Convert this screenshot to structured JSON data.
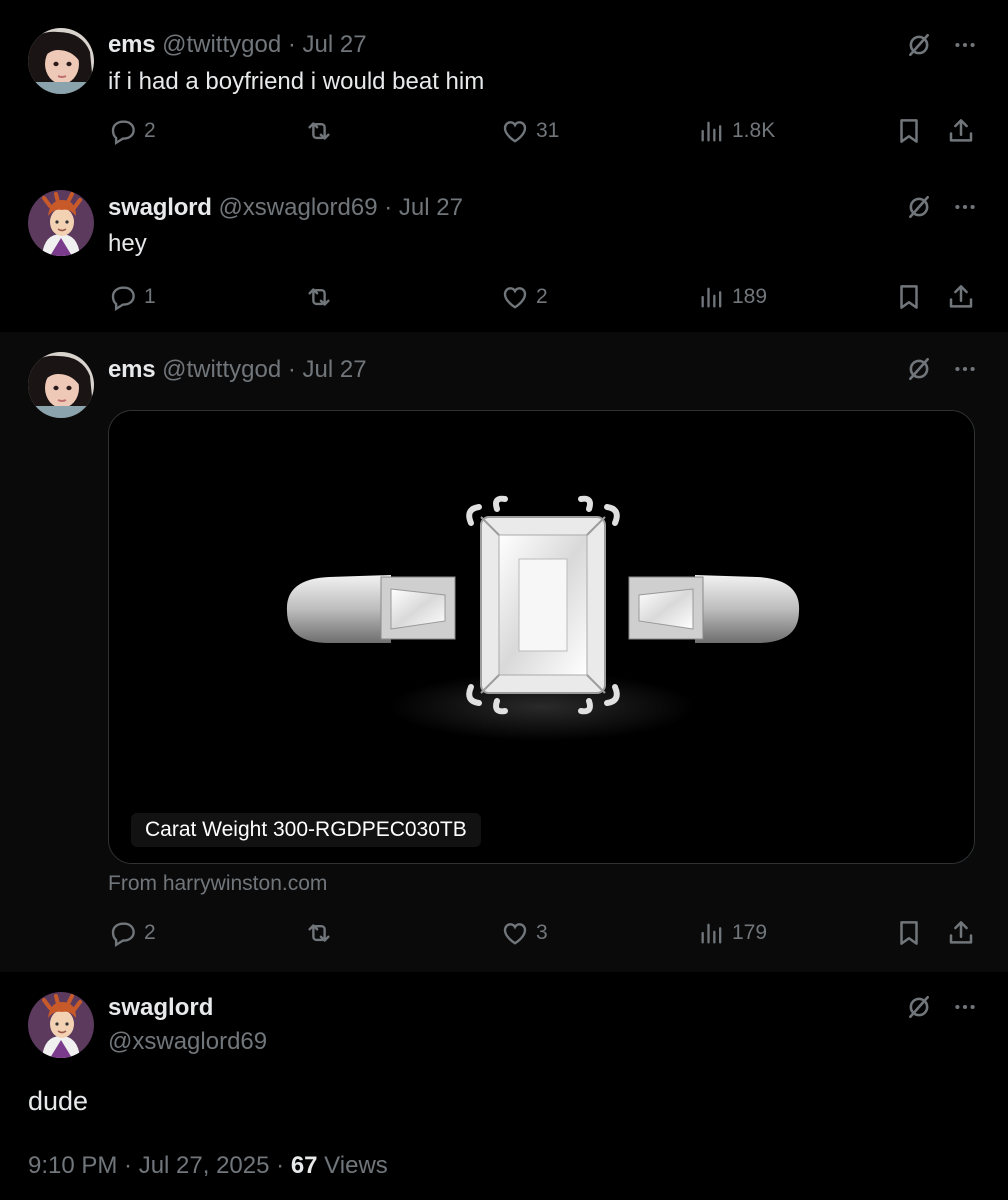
{
  "tweets": [
    {
      "name": "ems",
      "handle": "@twittygod",
      "sep": "·",
      "date": "Jul 27",
      "text": "if i had a boyfriend i would beat him",
      "replies": "2",
      "likes": "31",
      "views": "1.8K"
    },
    {
      "name": "swaglord",
      "handle": "@xswaglord69",
      "sep": "·",
      "date": "Jul 27",
      "text": "hey",
      "replies": "1",
      "likes": "2",
      "views": "189"
    },
    {
      "name": "ems",
      "handle": "@twittygod",
      "sep": "·",
      "date": "Jul 27",
      "card_caption": "Carat Weight 300-RGDPEC030TB",
      "card_source": "From harrywinston.com",
      "replies": "2",
      "likes": "3",
      "views": "179"
    }
  ],
  "main": {
    "name": "swaglord",
    "handle": "@xswaglord69",
    "text": "dude",
    "timestamp": "9:10 PM · Jul 27, 2025 · ",
    "views_count": "67",
    "views_label": " Views"
  },
  "icons": {
    "reply": "reply-icon",
    "retweet": "retweet-icon",
    "like": "heart-icon",
    "views": "analytics-icon",
    "bookmark": "bookmark-icon",
    "share": "share-icon",
    "grok": "grok-icon",
    "more": "more-icon"
  },
  "colors": {
    "background": "#000000",
    "secondary_text": "#71767b",
    "primary_text": "#e7e9ea",
    "thread_line": "#333639"
  }
}
